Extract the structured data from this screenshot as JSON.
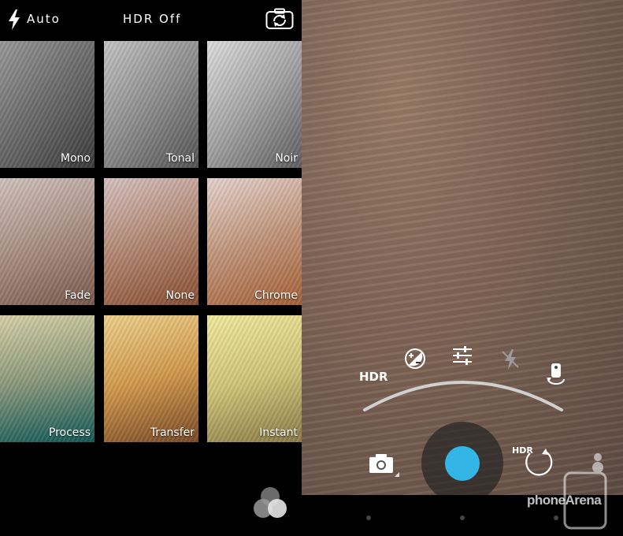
{
  "ios_camera": {
    "topbar": {
      "flash_icon": "lightning-icon",
      "flash_label": "Auto",
      "hdr_label": "HDR Off",
      "flip_icon": "camera-flip-icon"
    },
    "filters": [
      {
        "label": "Mono"
      },
      {
        "label": "Tonal"
      },
      {
        "label": "Noir"
      },
      {
        "label": "Fade"
      },
      {
        "label": "None"
      },
      {
        "label": "Chrome"
      },
      {
        "label": "Process"
      },
      {
        "label": "Transfer"
      },
      {
        "label": "Instant"
      }
    ],
    "filters_icon": "filter-circles-icon"
  },
  "android_camera": {
    "arc_menu": {
      "hdr_label": "HDR",
      "icons": [
        "exposure-icon",
        "settings-sliders-icon",
        "flash-off-icon",
        "timer-camera-icon"
      ]
    },
    "bottom": {
      "mode_icon": "camera-icon",
      "shutter_color": "#33b5e5",
      "hdr_small": "HDR",
      "photosphere_icon": "photosphere-icon"
    },
    "watermark": "phoneArena"
  }
}
